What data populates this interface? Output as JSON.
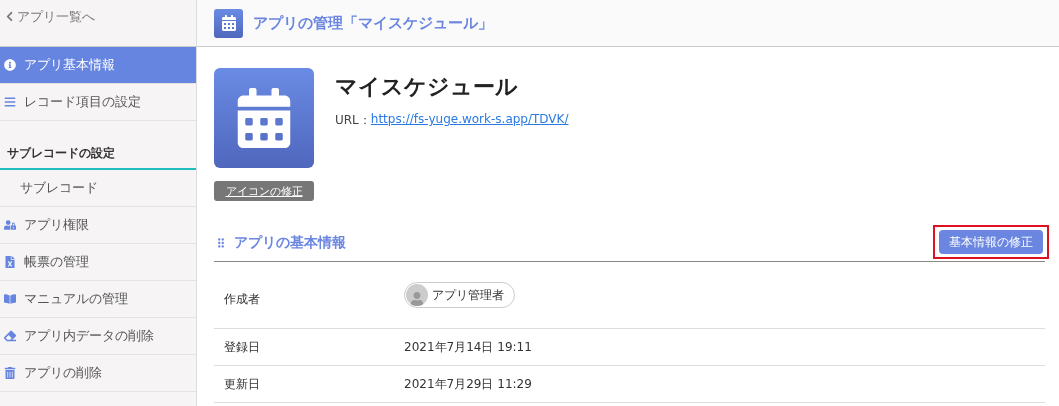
{
  "sidebar": {
    "back_link": "アプリ一覧へ",
    "items": [
      {
        "kind": "info",
        "label": "アプリ基本情報",
        "selected": true
      },
      {
        "kind": "list",
        "label": "レコード項目の設定",
        "selected": false
      },
      {
        "kind": "heading",
        "label": "サブレコードの設定"
      },
      {
        "kind": "sub",
        "label": "サブレコード",
        "selected": false
      },
      {
        "kind": "permission",
        "label": "アプリ権限",
        "selected": false
      },
      {
        "kind": "report",
        "label": "帳票の管理",
        "selected": false
      },
      {
        "kind": "manual",
        "label": "マニュアルの管理",
        "selected": false
      },
      {
        "kind": "erase",
        "label": "アプリ内データの削除",
        "selected": false
      },
      {
        "kind": "delete",
        "label": "アプリの削除",
        "selected": false
      }
    ]
  },
  "header": {
    "title": "アプリの管理「マイスケジュール」"
  },
  "app": {
    "name": "マイスケジュール",
    "url_label": "URL：",
    "url": "https://fs-yuge.work-s.app/TDVK/",
    "icon_button": "アイコンの修正"
  },
  "section": {
    "title": "アプリの基本情報",
    "edit_button": "基本情報の修正",
    "highlighted": true
  },
  "rows": [
    {
      "kind": "user",
      "label": "作成者",
      "value": "アプリ管理者"
    },
    {
      "kind": "text",
      "label": "登録日",
      "value": "2021年7月14日 19:11"
    },
    {
      "kind": "text",
      "label": "更新日",
      "value": "2021年7月29日 11:29"
    }
  ]
}
